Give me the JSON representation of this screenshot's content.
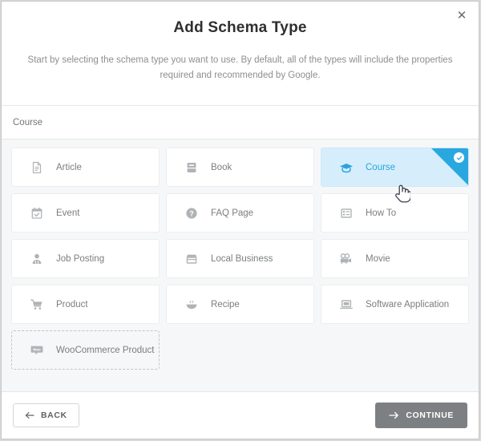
{
  "modal": {
    "title": "Add Schema Type",
    "subtitle": "Start by selecting the schema type you want to use. By default, all of the types will include the properties required and recommended by Google.",
    "close_label": "✕"
  },
  "search": {
    "value": "Course",
    "placeholder": "Course"
  },
  "colors": {
    "accent": "#29a8e0",
    "selected_background": "#d6eefb",
    "grid_background": "#f6f7f8",
    "icon_gray": "#b0b3b6",
    "label_gray": "#7a7d80",
    "continue_gray": "#7d8083"
  },
  "schema_types": [
    {
      "label": "Article",
      "icon": "article-icon",
      "selected": false,
      "dashed": false
    },
    {
      "label": "Book",
      "icon": "book-icon",
      "selected": false,
      "dashed": false
    },
    {
      "label": "Course",
      "icon": "graduation-cap-icon",
      "selected": true,
      "dashed": false
    },
    {
      "label": "Event",
      "icon": "calendar-icon",
      "selected": false,
      "dashed": false
    },
    {
      "label": "FAQ Page",
      "icon": "question-circle-icon",
      "selected": false,
      "dashed": false
    },
    {
      "label": "How To",
      "icon": "list-icon",
      "selected": false,
      "dashed": false
    },
    {
      "label": "Job Posting",
      "icon": "person-icon",
      "selected": false,
      "dashed": false
    },
    {
      "label": "Local Business",
      "icon": "storefront-icon",
      "selected": false,
      "dashed": false
    },
    {
      "label": "Movie",
      "icon": "film-camera-icon",
      "selected": false,
      "dashed": false
    },
    {
      "label": "Product",
      "icon": "shopping-cart-icon",
      "selected": false,
      "dashed": false
    },
    {
      "label": "Recipe",
      "icon": "bowl-icon",
      "selected": false,
      "dashed": false
    },
    {
      "label": "Software Application",
      "icon": "laptop-icon",
      "selected": false,
      "dashed": false
    },
    {
      "label": "WooCommerce Product",
      "icon": "woocommerce-icon",
      "selected": false,
      "dashed": true
    }
  ],
  "footer": {
    "back_label": "BACK",
    "continue_label": "CONTINUE"
  }
}
